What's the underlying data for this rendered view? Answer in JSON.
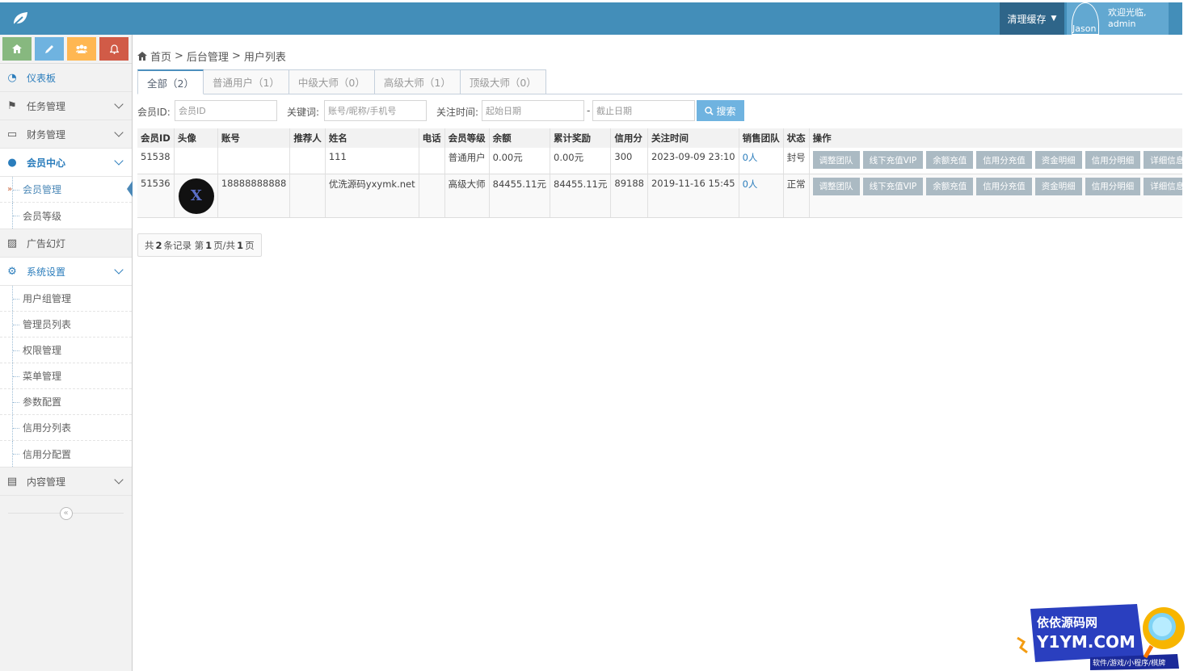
{
  "header": {
    "clear_cache": "清理缓存",
    "avatar_name": "Jason",
    "welcome_line1": "欢迎光临,",
    "welcome_line2": "admin",
    "bg": "#438eb9"
  },
  "shortcuts": [
    {
      "icon": "home-icon",
      "color": "#87b87f"
    },
    {
      "icon": "pencil-icon",
      "color": "#6fb3e0"
    },
    {
      "icon": "users-icon",
      "color": "#ffb752"
    },
    {
      "icon": "bell-icon",
      "color": "#d15b47"
    }
  ],
  "sidebar": {
    "dashboard": "仪表板",
    "task": "任务管理",
    "finance": "财务管理",
    "member_center": "会员中心",
    "member_manage": "会员管理",
    "member_level": "会员等级",
    "ads": "广告幻灯",
    "system": "系统设置",
    "system_items": [
      "用户组管理",
      "管理员列表",
      "权限管理",
      "菜单管理",
      "参数配置",
      "信用分列表",
      "信用分配置"
    ],
    "content": "内容管理"
  },
  "breadcrumb": {
    "home": "首页",
    "sep": ">",
    "admin": "后台管理",
    "current": "用户列表"
  },
  "tabs": [
    "全部（2）",
    "普通用户（1）",
    "中级大师（0）",
    "高级大师（1）",
    "顶级大师（0）"
  ],
  "filter": {
    "member_id_label": "会员ID:",
    "member_id_placeholder": "会员ID",
    "keyword_label": "关键词:",
    "keyword_placeholder": "账号/昵称/手机号",
    "time_label": "关注时间:",
    "start_placeholder": "起始日期",
    "dash": "-",
    "end_placeholder": "截止日期",
    "search": "搜索"
  },
  "table": {
    "headers": [
      "会员ID",
      "头像",
      "账号",
      "推荐人",
      "姓名",
      "电话",
      "会员等级",
      "余额",
      "累计奖励",
      "信用分",
      "关注时间",
      "销售团队",
      "状态",
      "操作"
    ],
    "rows": [
      {
        "id": "51538",
        "account": "",
        "referrer": "",
        "name": "111",
        "phone": "",
        "level": "普通用户",
        "balance": "0.00元",
        "reward": "0.00元",
        "credit": "300",
        "time": "2023-09-09 23:10",
        "team": "0人",
        "status": "封号"
      },
      {
        "id": "51536",
        "account": "18888888888",
        "referrer": "",
        "name": "优洗源码yxymk.net",
        "phone": "",
        "level": "高级大师",
        "balance": "84455.11元",
        "reward": "84455.11元",
        "credit": "89188",
        "time": "2019-11-16 15:45",
        "team": "0人",
        "status": "正常"
      }
    ],
    "ops": [
      "调整团队",
      "线下充值VIP",
      "余额充值",
      "信用分充值",
      "资金明细",
      "信用分明细",
      "详细信息"
    ]
  },
  "pager": {
    "t1": "共",
    "total": "2",
    "t2": "条记录 第",
    "page": "1",
    "t3": "页/共",
    "pages": "1",
    "t4": "页"
  },
  "watermark": {
    "line1": "依依源码网",
    "line2": "Y1YM.COM",
    "line3": "软件/游戏/小程序/棋牌"
  }
}
